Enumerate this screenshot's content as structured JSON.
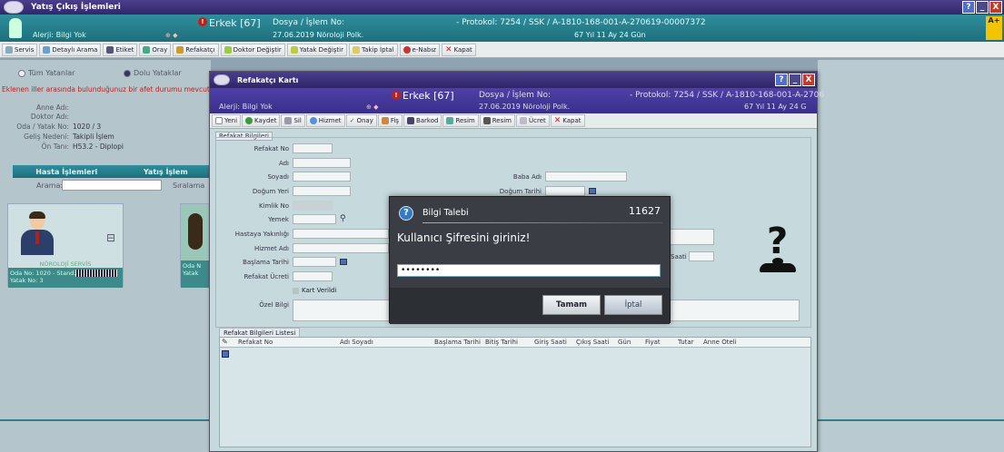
{
  "main_window": {
    "title": "Yatış Çıkış İşlemleri",
    "window_buttons": [
      "?",
      "_",
      "X"
    ],
    "patient_bar": {
      "allergy": "Alerji: Bilgi Yok",
      "gender": "Erkek [67]",
      "dosya_label": "Dosya / İşlem No:",
      "dosya_value": "27.06.2019 Nöroloji Polk.",
      "protocol": "- Protokol: 7254 / SSK / A-1810-168-001-A-270619-00007372",
      "age": "67 Yıl 11 Ay 24 Gün",
      "badge": "A+"
    },
    "toolbar": [
      "Servis",
      "Detaylı Arama",
      "Etiket",
      "Oray",
      "Refakatçı",
      "Doktor Değiştir",
      "Yatak Değiştir",
      "Takip İptal",
      "e-Nabız",
      "Kapat"
    ]
  },
  "left_panel": {
    "radio_all": "Tüm Yatanlar",
    "radio_full": "Dolu Yataklar",
    "warning": "Eklenen iller arasında bulunduğunuz bir afet durumu mevcut",
    "info": [
      {
        "label": "Anne Adı:",
        "value": ""
      },
      {
        "label": "Doktor Adı:",
        "value": ""
      },
      {
        "label": "Oda / Yatak No:",
        "value": "1020 / 3"
      },
      {
        "label": "Geliş Nedeni:",
        "value": "Takipli İşlem"
      },
      {
        "label": "Ön Tanı:",
        "value": "H53.2 - Diplopi"
      }
    ],
    "list_headers": [
      "Hasta İşlemleri",
      "Yatış İşlem"
    ],
    "search_label": "Arama:",
    "sort_label": "Sıralama",
    "card": {
      "service": "NÖROLOJİ SERVİS",
      "room": "Oda No: 1020 - Stand...",
      "bed": "Yatak No: 3"
    },
    "card2": {
      "room": "Oda N",
      "bed": "Yatak"
    }
  },
  "dialog": {
    "title": "Refakatçı Kartı",
    "window_buttons": [
      "?",
      "_",
      "X"
    ],
    "patient_bar": {
      "allergy": "Alerji: Bilgi Yok",
      "gender": "Erkek [67]",
      "dosya_label": "Dosya / İşlem No:",
      "dosya_value": "27.06.2019 Nöroloji Polk.",
      "protocol": "- Protokol: 7254 / SSK / A-1810-168-001-A-2706",
      "age": "67 Yıl 11 Ay 24 G"
    },
    "toolbar": [
      "Yeni",
      "Kaydet",
      "Sil",
      "Hizmet",
      "Onay",
      "Fiş",
      "Barkod",
      "Resim",
      "Resim",
      "Ücret",
      "Kapat"
    ],
    "section_title": "Refakat Bilgileri",
    "fields_left": [
      "Refakat No",
      "Adı",
      "Soyadı",
      "Doğum Yeri",
      "Kimlik No",
      "Yemek",
      "Hastaya Yakınlığı",
      "Hizmet Adı",
      "Başlama Tarihi",
      "Refakat Ücreti"
    ],
    "fields_right": [
      "Baba Adı",
      "Doğum Tarihi"
    ],
    "checkbox_label": "Kart Verildi",
    "ozel_bilgi": "Özel Bilgi",
    "saati": "Saati",
    "list_tab": "Refakat Bilgileri Listesi",
    "list_headers": [
      "Refakat No",
      "Adı Soyadı",
      "Başlama Tarihi",
      "Bitiş Tarihi",
      "Giriş Saati",
      "Çıkış Saati",
      "Gün",
      "Fiyat",
      "Tutar",
      "Anne Oteli"
    ]
  },
  "modal": {
    "title": "Bilgi Talebi",
    "code": "11627",
    "prompt": "Kullanıcı Şifresini giriniz!",
    "password_value": "••••••••",
    "ok_label": "Tamam",
    "cancel_label": "İptal"
  }
}
